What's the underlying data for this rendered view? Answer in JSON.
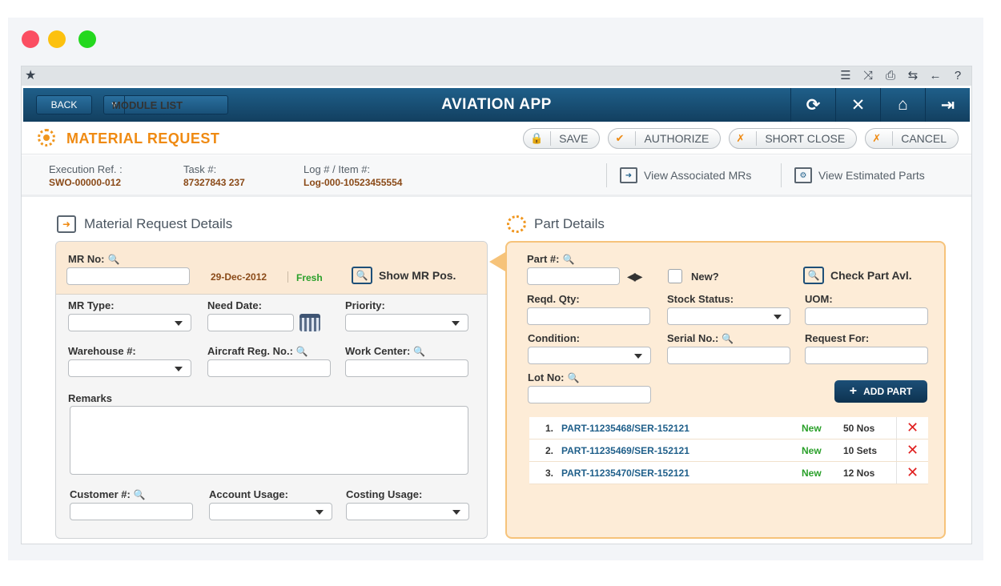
{
  "window": {
    "controls": [
      "close",
      "minimize",
      "maximize"
    ]
  },
  "utility_bar": {
    "icons": [
      "star-icon",
      "list-icon",
      "shuffle-icon",
      "print-icon",
      "repeat-icon",
      "arrow-left-icon",
      "help-icon"
    ]
  },
  "header": {
    "back_label": "BACK",
    "module_list_label": "MODULE LIST",
    "title": "AVIATION APP",
    "icons": [
      "refresh-icon",
      "close-icon",
      "home-icon",
      "logout-icon"
    ]
  },
  "page": {
    "title": "MATERIAL REQUEST",
    "actions": {
      "save": "SAVE",
      "authorize": "AUTHORIZE",
      "short_close": "SHORT CLOSE",
      "cancel": "CANCEL"
    }
  },
  "info": {
    "execution_ref_label": "Execution Ref. :",
    "execution_ref_value": "SWO-00000-012",
    "task_label": "Task #:",
    "task_value": "87327843 237",
    "log_label": "Log # / Item #:",
    "log_value": "Log-000-10523455554",
    "view_mrs": "View Associated MRs",
    "view_parts": "View Estimated Parts"
  },
  "mr_details": {
    "section_title": "Material Request Details",
    "mr_no_label": "MR No:",
    "date": "29-Dec-2012",
    "status": "Fresh",
    "show_mr_pos": "Show MR Pos.",
    "mr_type_label": "MR Type:",
    "need_date_label": "Need Date:",
    "priority_label": "Priority:",
    "warehouse_label": "Warehouse #:",
    "aircraft_reg_label": "Aircraft Reg. No.:",
    "work_center_label": "Work Center:",
    "remarks_label": "Remarks",
    "customer_label": "Customer #:",
    "account_usage_label": "Account Usage:",
    "costing_usage_label": "Costing Usage:"
  },
  "part_details": {
    "section_title": "Part Details",
    "part_no_label": "Part #:",
    "new_label": "New?",
    "check_avl": "Check Part Avl.",
    "reqd_qty_label": "Reqd. Qty:",
    "stock_status_label": "Stock Status:",
    "uom_label": "UOM:",
    "condition_label": "Condition:",
    "serial_no_label": "Serial No.:",
    "request_for_label": "Request For:",
    "lot_no_label": "Lot No:",
    "add_part": "ADD PART",
    "parts": [
      {
        "n": "1.",
        "part": "PART-11235468/SER-152121",
        "status": "New",
        "qty": "50 Nos"
      },
      {
        "n": "2.",
        "part": "PART-11235469/SER-152121",
        "status": "New",
        "qty": "10 Sets"
      },
      {
        "n": "3.",
        "part": "PART-11235470/SER-152121",
        "status": "New",
        "qty": "12 Nos"
      }
    ]
  }
}
